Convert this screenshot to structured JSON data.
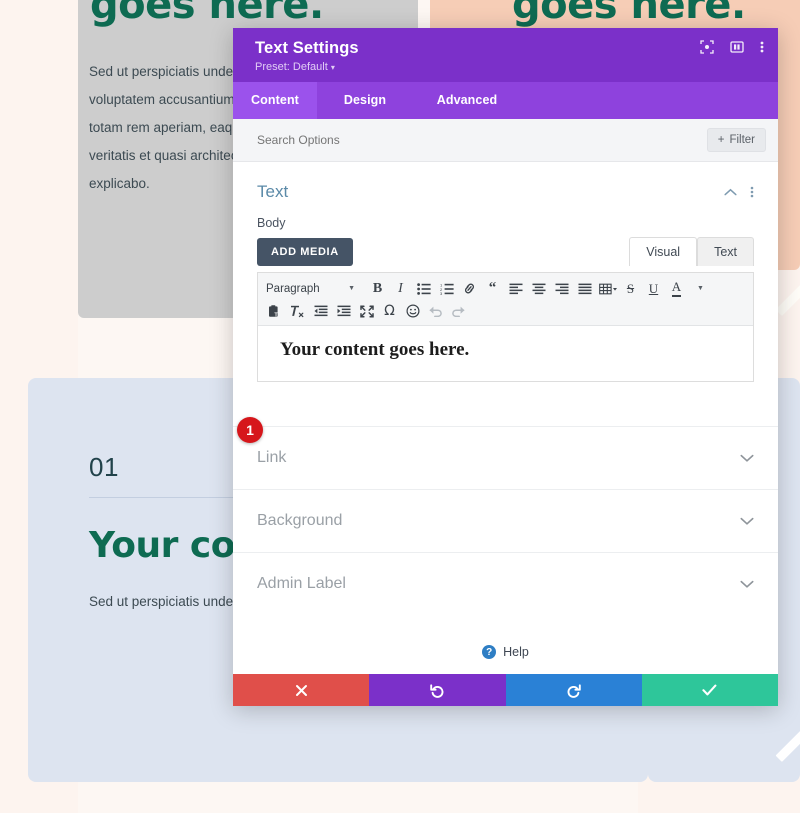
{
  "background": {
    "hero_heading": "goes here.",
    "hero_heading_right": "goes here.",
    "hero_paragraph": "Sed ut perspiciatis unde omnis iste natus error sit voluptatem accusantium doloremque laudantium, totam rem aperiam, eaque ipsa quae ab illo inventore veritatis et quasi architecto beatae vitae dicta sunt explicabo.",
    "number_label": "01",
    "section_heading": "Your con",
    "section_paragraph": "Sed ut perspiciatis unde omnis iste natus aperiam, eaque ipsa quae ab illo inventore"
  },
  "modal": {
    "title": "Text Settings",
    "preset": "Preset: Default",
    "header_icons": [
      {
        "name": "focus-frame-icon"
      },
      {
        "name": "layout-panel-icon"
      },
      {
        "name": "kebab-menu-icon"
      }
    ],
    "tabs": [
      {
        "label": "Content",
        "active": true
      },
      {
        "label": "Design",
        "active": false
      },
      {
        "label": "Advanced",
        "active": false
      }
    ],
    "search": {
      "placeholder": "Search Options",
      "value": "",
      "filter_label": "Filter",
      "filter_icon": "plus-icon"
    },
    "section": {
      "title": "Text",
      "collapse_icon": "chevron-up-icon",
      "more_icon": "kebab-menu-icon"
    },
    "body_field": {
      "label": "Body",
      "add_media_label": "ADD MEDIA",
      "editor_tabs": [
        {
          "label": "Visual",
          "active": true
        },
        {
          "label": "Text",
          "active": false
        }
      ],
      "content": "Your content goes here.",
      "marker_badge": "1"
    },
    "toolbar_row1": [
      {
        "name": "paragraph-format-select",
        "label": "Paragraph",
        "type": "select"
      },
      {
        "name": "bold-icon",
        "glyph": "B",
        "type": "bold"
      },
      {
        "name": "italic-icon",
        "glyph": "I",
        "type": "italic"
      },
      {
        "name": "bullet-list-icon",
        "type": "ul"
      },
      {
        "name": "numbered-list-icon",
        "type": "ol"
      },
      {
        "name": "link-icon",
        "type": "link"
      },
      {
        "name": "blockquote-icon",
        "glyph": "“",
        "type": "quote"
      },
      {
        "name": "align-left-icon",
        "type": "align-left"
      },
      {
        "name": "align-center-icon",
        "type": "align-center"
      },
      {
        "name": "align-right-icon",
        "type": "align-right"
      },
      {
        "name": "align-justify-icon",
        "type": "align-justify"
      },
      {
        "name": "table-icon",
        "type": "table"
      },
      {
        "name": "strikethrough-icon",
        "glyph": "S",
        "type": "strike"
      },
      {
        "name": "underline-icon",
        "glyph": "U",
        "type": "underline"
      },
      {
        "name": "text-color-icon",
        "glyph": "A",
        "type": "textcolor"
      }
    ],
    "toolbar_row2": [
      {
        "name": "paste-as-text-icon",
        "type": "paste"
      },
      {
        "name": "clear-formatting-icon",
        "type": "clearfmt"
      },
      {
        "name": "outdent-icon",
        "type": "outdent"
      },
      {
        "name": "indent-icon",
        "type": "indent"
      },
      {
        "name": "fullscreen-icon",
        "type": "fullscreen"
      },
      {
        "name": "special-character-icon",
        "glyph": "Ω",
        "type": "omega"
      },
      {
        "name": "emoji-icon",
        "type": "emoji"
      },
      {
        "name": "undo-icon",
        "type": "undo",
        "disabled": true
      },
      {
        "name": "redo-icon",
        "type": "redo",
        "disabled": true
      }
    ],
    "accordions": [
      {
        "label": "Link",
        "icon": "chevron-down-icon"
      },
      {
        "label": "Background",
        "icon": "chevron-down-icon"
      },
      {
        "label": "Admin Label",
        "icon": "chevron-down-icon"
      }
    ],
    "help": {
      "label": "Help",
      "icon": "question-circle-icon"
    },
    "footer_buttons": [
      {
        "name": "cancel-button",
        "icon": "close-x-icon",
        "color": "#e04f4a"
      },
      {
        "name": "undo-button",
        "icon": "undo-arrow-icon",
        "color": "#7b30c9"
      },
      {
        "name": "redo-button",
        "icon": "redo-arrow-icon",
        "color": "#2a81d6"
      },
      {
        "name": "save-button",
        "icon": "checkmark-icon",
        "color": "#2ec69a"
      }
    ]
  },
  "colors": {
    "purple_header": "#7b30c9",
    "purple_tabs": "#8e42dd",
    "purple_active": "#9b52ec",
    "teal_heading": "#0e6b52",
    "badge_red": "#d6161b"
  }
}
